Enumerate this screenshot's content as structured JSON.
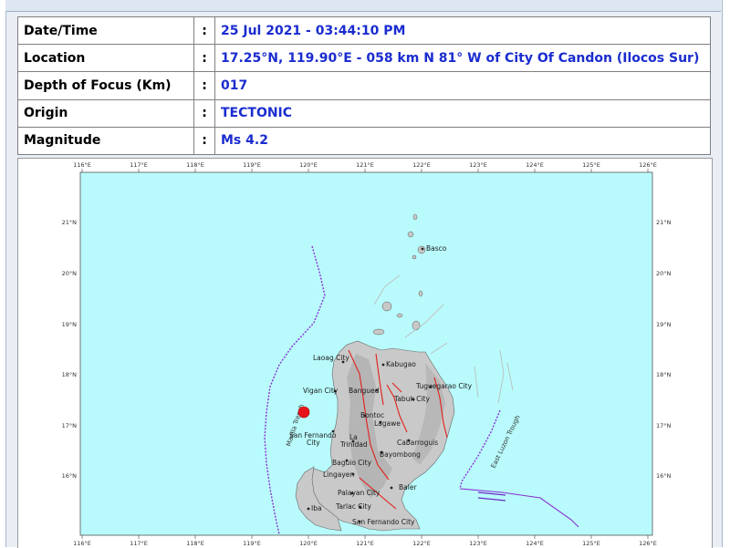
{
  "info": {
    "rows": [
      {
        "label": "Date/Time",
        "colon": ":",
        "value": "25 Jul 2021 - 03:44:10 PM"
      },
      {
        "label": "Location",
        "colon": ":",
        "value": "17.25°N, 119.90°E - 058 km N 81° W of City Of Candon (Ilocos Sur)"
      },
      {
        "label": "Depth of Focus (Km)",
        "colon": ":",
        "value": "017"
      },
      {
        "label": "Origin",
        "colon": ":",
        "value": "TECTONIC"
      },
      {
        "label": "Magnitude",
        "colon": ":",
        "value": "Ms 4.2"
      }
    ]
  },
  "map": {
    "lon_labels": [
      "116°E",
      "117°E",
      "118°E",
      "119°E",
      "120°E",
      "121°E",
      "122°E",
      "123°E",
      "124°E",
      "125°E",
      "126°E"
    ],
    "lat_labels": [
      "21°N",
      "20°N",
      "19°N",
      "18°N",
      "17°N",
      "16°N"
    ],
    "cities": {
      "basco": "Basco",
      "laoag": "Laoag City",
      "kabugao": "Kabugao",
      "tuguegarao": "Tuguegarao City",
      "vigan": "Vigan City",
      "bangued": "Bangued",
      "tabuk": "Tabuk City",
      "bontoc": "Bontoc",
      "lagawe": "Lagawe",
      "sanfernando_lu_1": "San Fernando",
      "sanfernando_lu_2": "City",
      "la_trinidad_1": "La",
      "la_trinidad_2": "Trinidad",
      "cabarroguis": "Cabarroguis",
      "bayombong": "Bayombong",
      "baguio": "Baguio City",
      "lingayen": "Lingayen",
      "baler": "Baler",
      "palayan": "Palayan City",
      "iba": "Iba",
      "tarlac": "Tarlac City",
      "sanfernando_pa": "San Fernando City"
    },
    "trenches": {
      "manila": "Manila Trench",
      "east_luzon": "East Luzon Trough"
    },
    "colors": {
      "sea": "#b9fbfc",
      "land": "#c8c8c8",
      "fault": "#e0201a",
      "trench": "#8b2fd6",
      "epicenter": "#e8141c"
    },
    "epicenter": {
      "lat": 17.25,
      "lon": 119.9
    }
  }
}
